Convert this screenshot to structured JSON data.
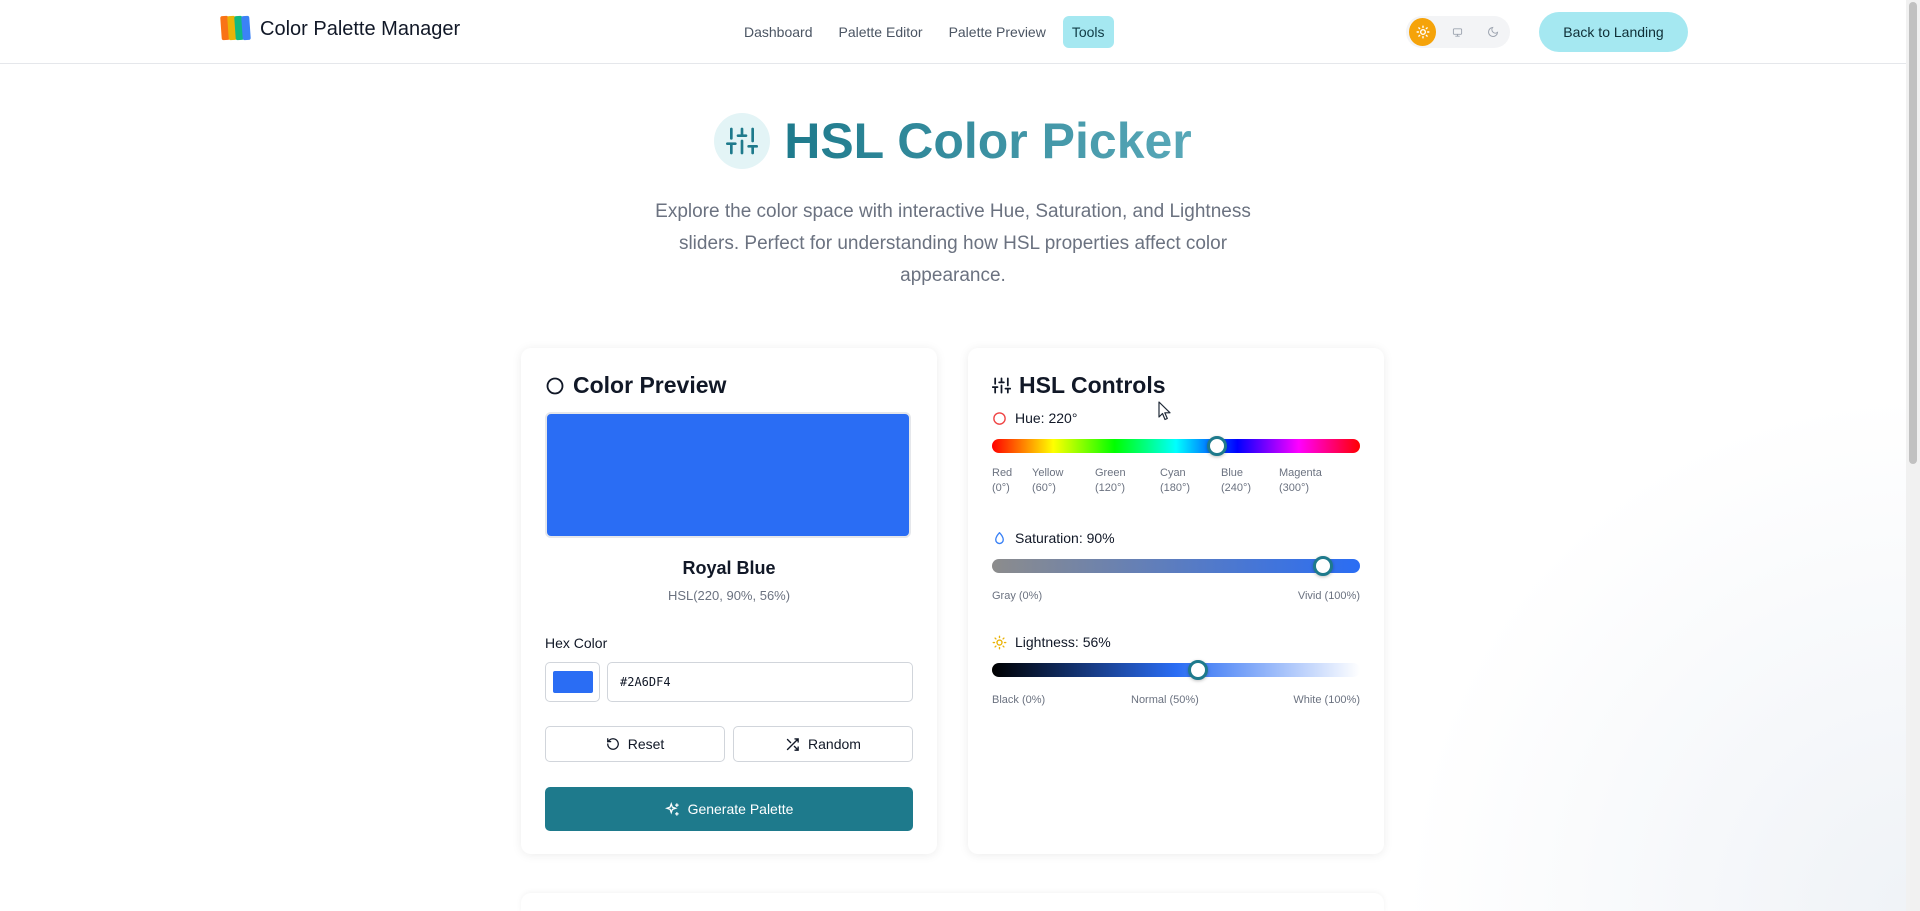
{
  "header": {
    "brand_title": "Color Palette Manager",
    "nav": [
      "Dashboard",
      "Palette Editor",
      "Palette Preview",
      "Tools"
    ],
    "active_nav": "Tools",
    "back_button": "Back to Landing",
    "theme_modes": [
      "sun-icon",
      "monitor-icon",
      "moon-icon"
    ],
    "active_theme": "light"
  },
  "hero": {
    "title": "HSL Color Picker",
    "subtitle": "Explore the color space with interactive Hue, Saturation, and Lightness sliders. Perfect for understanding how HSL properties affect color appearance."
  },
  "preview": {
    "title": "Color Preview",
    "color_name": "Royal Blue",
    "hsl_text": "HSL(220, 90%, 56%)",
    "hex_label": "Hex Color",
    "hex_value": "#2A6DF4",
    "reset_label": "Reset",
    "random_label": "Random",
    "generate_label": "Generate Palette"
  },
  "controls": {
    "title": "HSL Controls",
    "hue": {
      "label": "Hue: 220°",
      "value": 220,
      "max": 360,
      "marks": [
        {
          "name": "Red",
          "deg": "(0°)"
        },
        {
          "name": "Yellow",
          "deg": "(60°)"
        },
        {
          "name": "Green",
          "deg": "(120°)"
        },
        {
          "name": "Cyan",
          "deg": "(180°)"
        },
        {
          "name": "Blue",
          "deg": "(240°)"
        },
        {
          "name": "Magenta",
          "deg": "(300°)"
        }
      ]
    },
    "saturation": {
      "label": "Saturation: 90%",
      "value": 90,
      "min_label": "Gray (0%)",
      "max_label": "Vivid (100%)"
    },
    "lightness": {
      "label": "Lightness: 56%",
      "value": 56,
      "min_label": "Black (0%)",
      "mid_label": "Normal (50%)",
      "max_label": "White (100%)"
    }
  },
  "colors": {
    "current": "#2A6DF4",
    "accent": "#1E7A8C",
    "nav_active_bg": "#A5E8F1",
    "theme_active": "#F5A30A"
  }
}
